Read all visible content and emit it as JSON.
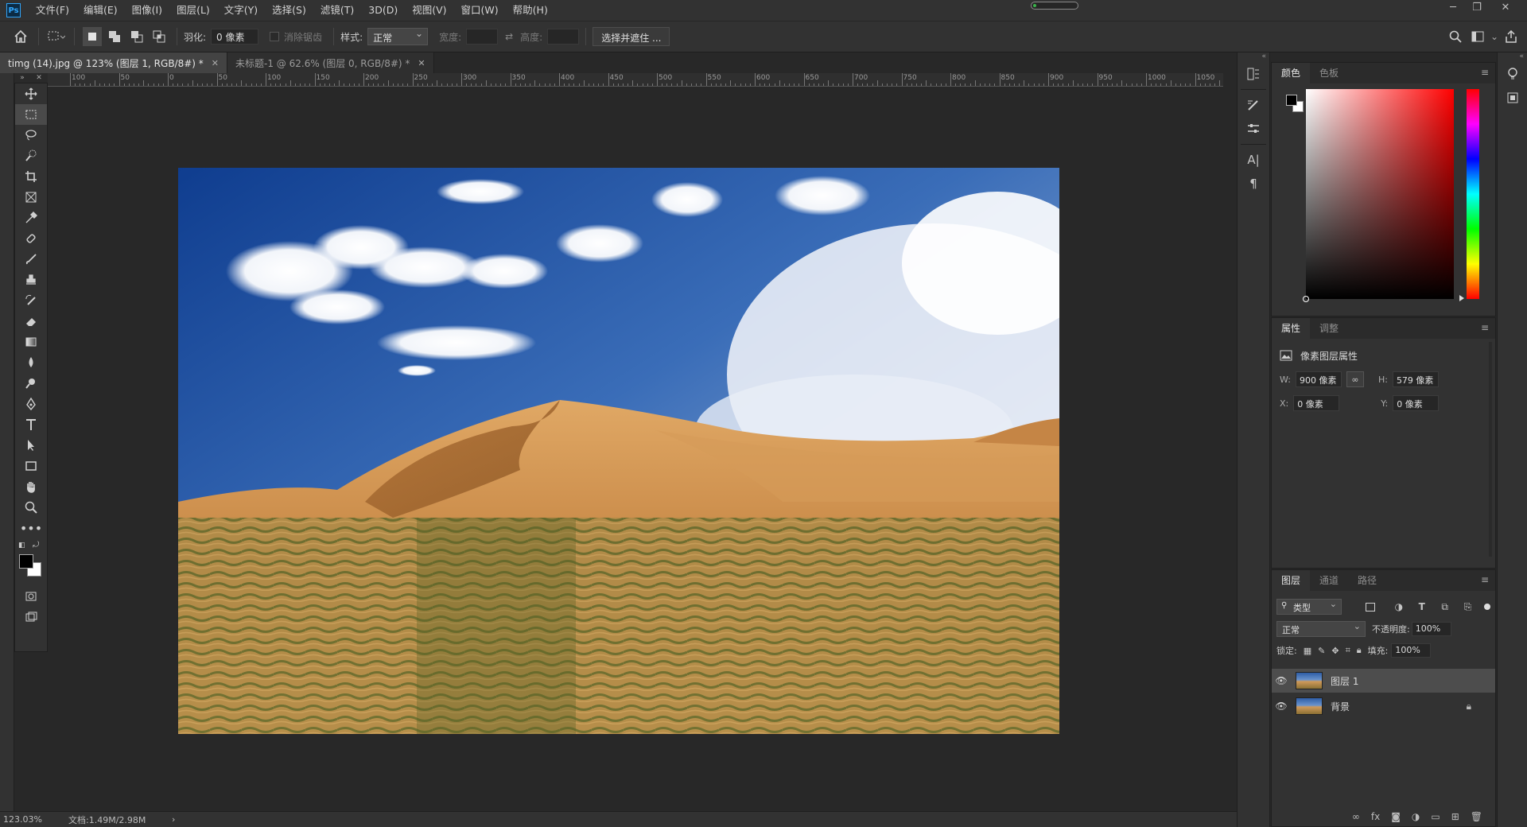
{
  "app": {
    "logo": "Ps",
    "menu": [
      "文件(F)",
      "编辑(E)",
      "图像(I)",
      "图层(L)",
      "文字(Y)",
      "选择(S)",
      "滤镜(T)",
      "3D(D)",
      "视图(V)",
      "窗口(W)",
      "帮助(H)"
    ],
    "window_controls": [
      "minimize-icon",
      "restore-icon",
      "close-icon"
    ]
  },
  "options": {
    "feather_label": "羽化:",
    "feather_value": "0 像素",
    "antialias_label": "消除锯齿",
    "style_label": "样式:",
    "style_value": "正常",
    "width_label": "宽度:",
    "height_label": "高度:",
    "select_mask_button": "选择并遮住 ..."
  },
  "tabs": [
    {
      "label": "timg (14).jpg @ 123% (图层 1, RGB/8#) *",
      "active": true
    },
    {
      "label": "未标题-1 @ 62.6% (图层 0, RGB/8#) *",
      "active": false
    }
  ],
  "ruler": {
    "labels": [
      "100",
      "50",
      "0",
      "50",
      "100",
      "150",
      "200",
      "250",
      "300",
      "350",
      "400",
      "450",
      "500",
      "550",
      "600",
      "650",
      "700",
      "750",
      "800",
      "850",
      "900",
      "950",
      "1000",
      "1050"
    ]
  },
  "status": {
    "zoom": "123.03%",
    "doc": "文档:1.49M/2.98M",
    "arrow": "›"
  },
  "color_panel": {
    "tabs": [
      "颜色",
      "色板"
    ],
    "foreground": "#000000",
    "background": "#ffffff",
    "picker_hue": "#ff0000"
  },
  "properties_panel": {
    "tabs": [
      "属性",
      "调整"
    ],
    "title": "像素图层属性",
    "w_label": "W:",
    "w_value": "900 像素",
    "h_label": "H:",
    "h_value": "579 像素",
    "x_label": "X:",
    "x_value": "0 像素",
    "y_label": "Y:",
    "y_value": "0 像素"
  },
  "layers_panel": {
    "tabs": [
      "图层",
      "通道",
      "路径"
    ],
    "filter_label": "类型",
    "blend_mode": "正常",
    "opacity_label": "不透明度:",
    "opacity_value": "100%",
    "lock_label": "锁定:",
    "fill_label": "填充:",
    "fill_value": "100%",
    "layers": [
      {
        "name": "图层 1",
        "selected": true,
        "locked": false
      },
      {
        "name": "背景",
        "selected": false,
        "locked": true
      }
    ]
  }
}
